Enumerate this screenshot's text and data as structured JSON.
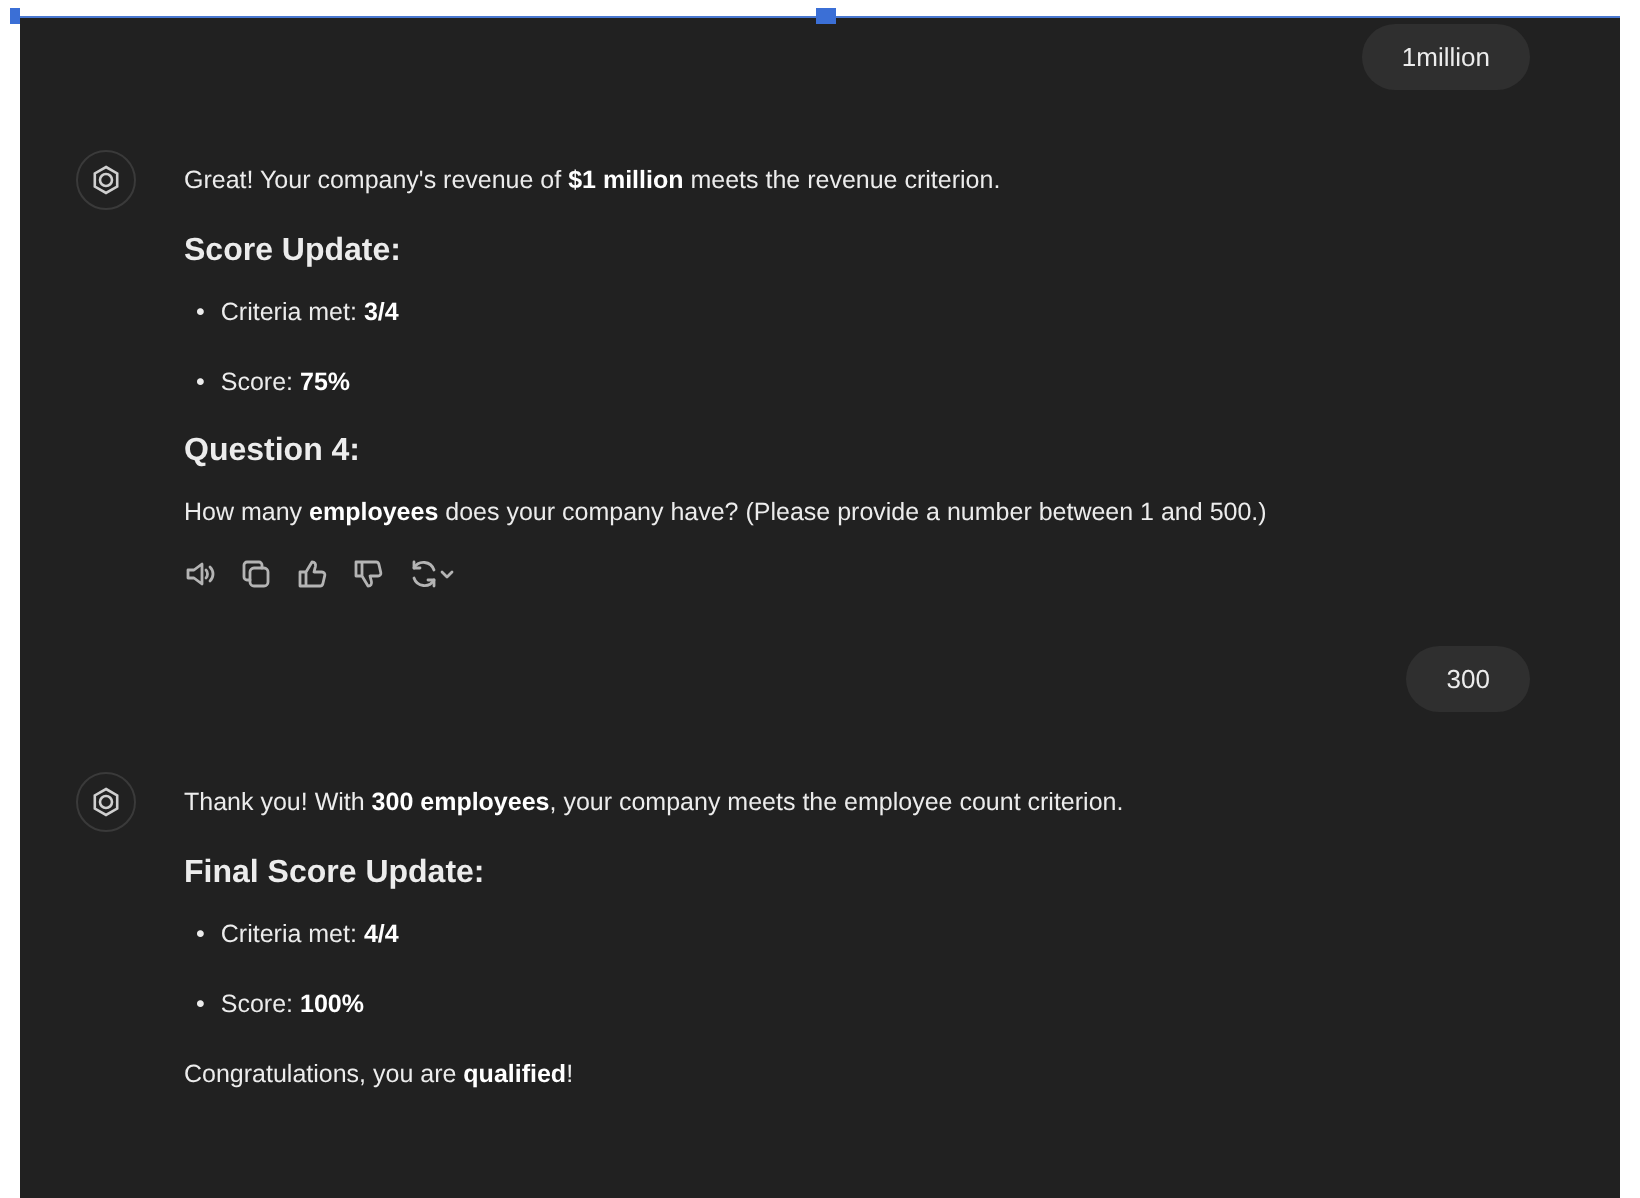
{
  "messages": [
    {
      "kind": "user",
      "text": "1million"
    },
    {
      "kind": "assistant",
      "blocks": [
        {
          "kind": "paragraph",
          "text": "Great! Your company's revenue of **$1 million** meets the revenue criterion."
        },
        {
          "kind": "heading",
          "text": "Score Update:"
        },
        {
          "kind": "bullets",
          "items": [
            {
              "marker": "•",
              "text": "Criteria met: **3/4**"
            },
            {
              "marker": "•",
              "text": "Score: **75%**"
            }
          ]
        },
        {
          "kind": "heading",
          "text": "Question 4:"
        },
        {
          "kind": "paragraph",
          "text": "How many **employees** does your company have? (Please provide a number between 1 and 500.)"
        },
        {
          "kind": "actions"
        }
      ]
    },
    {
      "kind": "user",
      "text": "300"
    },
    {
      "kind": "assistant",
      "blocks": [
        {
          "kind": "paragraph",
          "text": "Thank you! With **300 employees**, your company meets the employee count criterion."
        },
        {
          "kind": "heading",
          "text": "Final Score Update:"
        },
        {
          "kind": "bullets",
          "items": [
            {
              "marker": "•",
              "text": "Criteria met: **4/4**"
            },
            {
              "marker": "•",
              "text": "Score: **100%**"
            }
          ]
        },
        {
          "kind": "paragraph",
          "text": "Congratulations, you are **qualified**!"
        }
      ]
    }
  ]
}
